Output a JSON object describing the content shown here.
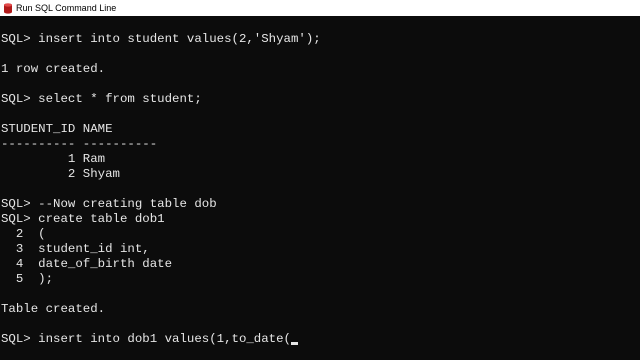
{
  "window": {
    "title": "Run SQL Command Line",
    "icon": "database-icon"
  },
  "console": {
    "lines": [
      "SQL> insert into student values(2,'Shyam');",
      "1 row created.",
      "SQL> select * from student;",
      "STUDENT_ID NAME",
      "---------- ----------",
      "         1 Ram",
      "         2 Shyam",
      "SQL> --Now creating table dob",
      "SQL> create table dob1",
      "  2  (",
      "  3  student_id int,",
      "  4  date_of_birth date",
      "  5  );",
      "Table created.",
      "SQL> insert into dob1 values(1,to_date("
    ],
    "cursor": "blinking-underscore-cursor"
  },
  "colors": {
    "background": "#0c0c0c",
    "text": "#e6e6e6",
    "titlebar": "#ffffff"
  }
}
